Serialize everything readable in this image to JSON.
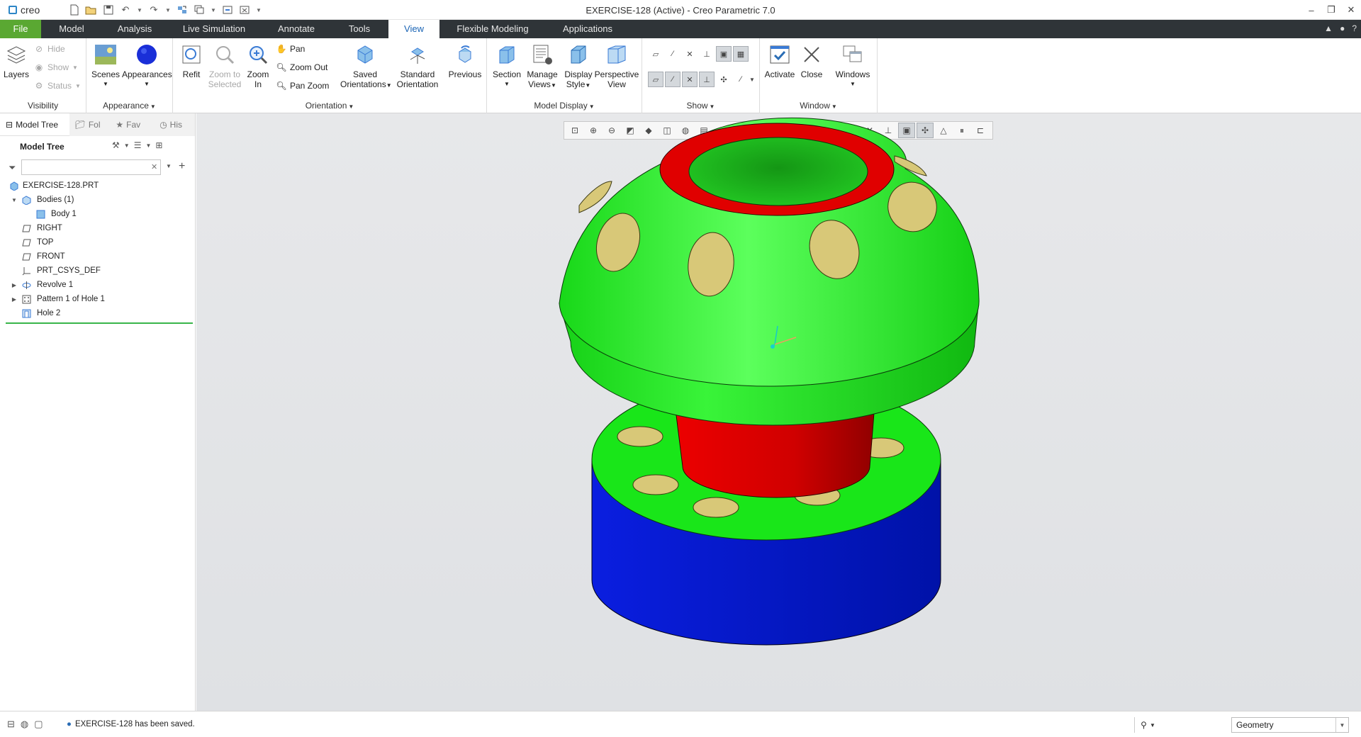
{
  "app": {
    "logo_text": "creo",
    "window_title": "EXERCISE-128 (Active) - Creo Parametric 7.0"
  },
  "quick_access": {
    "icons": [
      "new-icon",
      "open-icon",
      "save-icon",
      "undo-icon",
      "redo-icon",
      "regenerate-icon",
      "windows-icon",
      "switch-icon",
      "close-window-icon",
      "customize-icon"
    ]
  },
  "window_controls": {
    "minimize": "–",
    "restore": "❐",
    "close": "✕"
  },
  "tabs": [
    {
      "label": "File"
    },
    {
      "label": "Model"
    },
    {
      "label": "Analysis"
    },
    {
      "label": "Live Simulation"
    },
    {
      "label": "Annotate"
    },
    {
      "label": "Tools"
    },
    {
      "label": "View"
    },
    {
      "label": "Flexible Modeling"
    },
    {
      "label": "Applications"
    }
  ],
  "active_tab": "View",
  "ribbon": {
    "visibility": {
      "label": "Visibility",
      "layers": "Layers",
      "hide": "Hide",
      "show": "Show",
      "status": "Status"
    },
    "appearance": {
      "label": "Appearance",
      "scenes": "Scenes",
      "appearances": "Appearances"
    },
    "orientation": {
      "label": "Orientation",
      "refit": "Refit",
      "zoom_to_selected_1": "Zoom to",
      "zoom_to_selected_2": "Selected",
      "zoom_in_1": "Zoom",
      "zoom_in_2": "In",
      "pan": "Pan",
      "zoom_out": "Zoom Out",
      "pan_zoom": "Pan Zoom",
      "saved_orientations_1": "Saved",
      "saved_orientations_2": "Orientations",
      "standard_orientation_1": "Standard",
      "standard_orientation_2": "Orientation",
      "previous": "Previous"
    },
    "model_display": {
      "label": "Model Display",
      "section": "Section",
      "manage_views_1": "Manage",
      "manage_views_2": "Views",
      "display_style_1": "Display",
      "display_style_2": "Style",
      "perspective_view_1": "Perspective",
      "perspective_view_2": "View"
    },
    "show": {
      "label": "Show"
    },
    "window": {
      "label": "Window",
      "activate": "Activate",
      "close": "Close",
      "windows": "Windows"
    }
  },
  "left_panel": {
    "tabs": [
      "Model Tree",
      "Folder Browser",
      "Favorites",
      "History"
    ],
    "tab_visible": [
      "Model Tree",
      "Fol",
      "Fav",
      "His"
    ],
    "tree_title": "Model Tree",
    "search_placeholder": "",
    "tree": [
      {
        "label": "EXERCISE-128.PRT",
        "level": 0,
        "expander": "",
        "icon": "part-icon"
      },
      {
        "label": "Bodies (1)",
        "level": 0,
        "expander": "▼",
        "icon": "bodies-icon"
      },
      {
        "label": "Body 1",
        "level": 1,
        "expander": "",
        "icon": "body-icon"
      },
      {
        "label": "RIGHT",
        "level": 0,
        "expander": "",
        "icon": "datum-plane-icon"
      },
      {
        "label": "TOP",
        "level": 0,
        "expander": "",
        "icon": "datum-plane-icon"
      },
      {
        "label": "FRONT",
        "level": 0,
        "expander": "",
        "icon": "datum-plane-icon"
      },
      {
        "label": "PRT_CSYS_DEF",
        "level": 0,
        "expander": "",
        "icon": "csys-icon"
      },
      {
        "label": "Revolve 1",
        "level": 0,
        "expander": "▶",
        "icon": "revolve-icon"
      },
      {
        "label": "Pattern 1 of Hole 1",
        "level": 0,
        "expander": "▶",
        "icon": "pattern-icon"
      },
      {
        "label": "Hole 2",
        "level": 0,
        "expander": "",
        "icon": "hole-icon"
      }
    ]
  },
  "status_bar": {
    "message": "EXERCISE-128 has been saved.",
    "selection_filter": "Geometry"
  },
  "colors": {
    "file_tab": "#5aa832",
    "tab_bar": "#2f3438",
    "model_green": "#19e619",
    "model_red": "#e00000",
    "model_blue": "#0018d0",
    "hole_tan": "#d8c878"
  }
}
